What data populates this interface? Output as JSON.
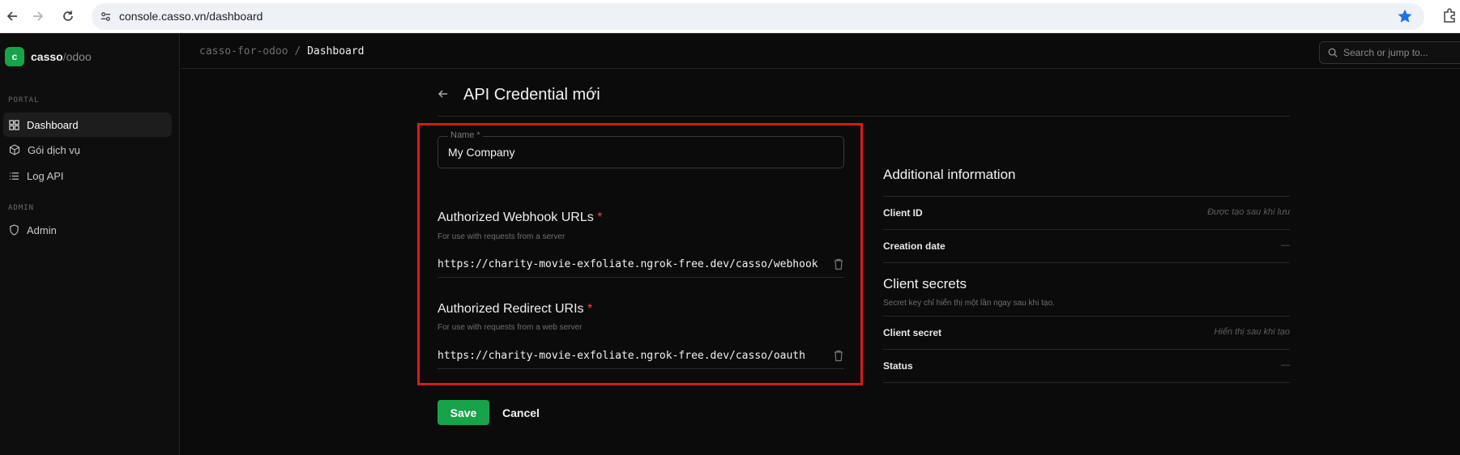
{
  "browser": {
    "url": "console.casso.vn/dashboard"
  },
  "sidebar": {
    "brand_name": "casso",
    "brand_sep": "/",
    "brand_sub": "odoo",
    "logo_letter": "c",
    "portal_label": "PORTAL",
    "admin_label": "ADMIN",
    "items": [
      {
        "label": "Dashboard",
        "icon": "dashboard-icon"
      },
      {
        "label": "Gói dịch vụ",
        "icon": "package-icon"
      },
      {
        "label": "Log API",
        "icon": "list-icon"
      },
      {
        "label": "Admin",
        "icon": "shield-icon"
      }
    ]
  },
  "topbar": {
    "crumb_root": "casso-for-odoo",
    "crumb_sep": "/",
    "crumb_current": "Dashboard",
    "search_placeholder": "Search or jump to..."
  },
  "form": {
    "title": "API Credential mới",
    "name_label": "Name *",
    "name_value": "My Company",
    "webhook_title": "Authorized Webhook URLs",
    "webhook_help": "For use with requests from a server",
    "webhook_url": "https://charity-movie-exfoliate.ngrok-free.dev/casso/webhook",
    "redirect_title": "Authorized Redirect URIs",
    "redirect_help": "For use with requests from a web server",
    "redirect_url": "https://charity-movie-exfoliate.ngrok-free.dev/casso/oauth",
    "required_mark": "*",
    "save_label": "Save",
    "cancel_label": "Cancel"
  },
  "info": {
    "title": "Additional information",
    "client_id_key": "Client ID",
    "client_id_val": "Được tạo sau khi lưu",
    "creation_key": "Creation date",
    "creation_val": "—",
    "secrets_title": "Client secrets",
    "secrets_help": "Secret key chỉ hiển thị một lần ngay sau khi tạo.",
    "secret_key": "Client secret",
    "secret_val": "Hiển thị sau khi tạo",
    "status_key": "Status",
    "status_val": "—"
  },
  "colors": {
    "accent": "#16a34a",
    "highlight": "#d71920",
    "required": "#ef4444"
  }
}
